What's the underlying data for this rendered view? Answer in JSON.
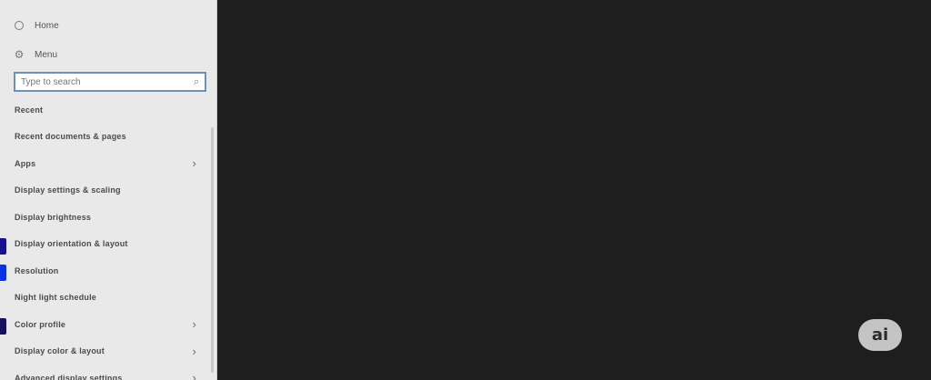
{
  "sidebar": {
    "top_items": [
      {
        "label": "Home",
        "icon": "clock-icon"
      },
      {
        "label": "Menu",
        "icon": "settings-icon"
      }
    ],
    "search": {
      "placeholder": "Type to search"
    },
    "items": [
      {
        "label": "Recent"
      },
      {
        "label": "Recent documents & pages"
      },
      {
        "label": "Apps",
        "has_chevron": true
      },
      {
        "label": "Display settings & scaling"
      },
      {
        "label": "Display brightness"
      },
      {
        "label": "Display orientation & layout",
        "indicator_color": "#1a0f8f"
      },
      {
        "label": "Resolution",
        "indicator_color": "#0a31e6"
      },
      {
        "label": "Night light schedule"
      },
      {
        "label": "Color profile",
        "has_chevron": true,
        "indicator_color": "#16105e"
      },
      {
        "label": "Display color & layout",
        "has_chevron": true
      },
      {
        "label": "Advanced display settings",
        "has_chevron": true
      }
    ]
  },
  "assistant": {
    "label": "ai"
  },
  "colors": {
    "panel_bg": "#e9e9e9",
    "main_bg": "#1e1e1e",
    "search_border": "#6f8fb8",
    "ai_button_bg": "#c4c4c4"
  }
}
